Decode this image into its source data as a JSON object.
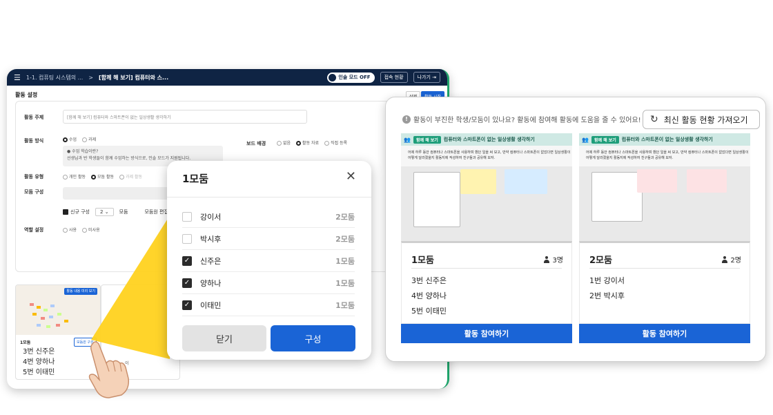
{
  "app": {
    "breadcrumb": "1-1. 컴퓨팅 시스템의 ...",
    "title": "[함께 해 보기] 컴퓨터와 스...",
    "mode_toggle": "인솔 모드 OFF",
    "access_status": "접속 현황",
    "exit": "나가기",
    "section_title": "활동 설정",
    "delete_btn": "삭제",
    "start_btn": "활동 시작",
    "fields": {
      "topic_label": "활동 주제",
      "topic_value": "[함께 해 보기] 컴퓨터와 스마트폰이 없는 일상생활 생각하기",
      "method_label": "활동 방식",
      "method_opt1": "수업",
      "method_opt2": "과제",
      "info_title": "수업 학습이란?",
      "info_text": "선생님과 반 학생들이 함께 수업하는 방식으로, 인솔 모드가 지원됩니다.",
      "board_label": "보드 배경",
      "board_opt1": "없음",
      "board_opt2": "활동 자료",
      "board_opt3": "직접 등록",
      "type_label": "활동 유형",
      "type_opt1": "개인 활동",
      "type_opt2": "모둠 활동",
      "type_opt3": "과제 활동",
      "group_label": "모둠 구성",
      "new_group": "신규 구성",
      "group_count": "2",
      "group_unit": "모둠",
      "group_edit": "모둠원 편집 편성",
      "role_label": "역할 설정",
      "role_opt1": "사용",
      "role_opt2": "미사용"
    },
    "thumb": {
      "badge": "활동 내용 미리 보기",
      "name": "1모둠",
      "btn": "모둠원 구성",
      "members": [
        "3번 신주은",
        "4번 양하나",
        "5번 이태민"
      ],
      "card2_text": "이"
    }
  },
  "modal": {
    "title": "1모둠",
    "rows": [
      {
        "name": "강이서",
        "group": "2모둠",
        "checked": false
      },
      {
        "name": "박시후",
        "group": "2모둠",
        "checked": false
      },
      {
        "name": "신주은",
        "group": "1모둠",
        "checked": true
      },
      {
        "name": "양하나",
        "group": "1모둠",
        "checked": true
      },
      {
        "name": "이태민",
        "group": "1모둠",
        "checked": true
      }
    ],
    "close_label": "닫기",
    "compose_label": "구성"
  },
  "right": {
    "notice": "활동이 부진한 학생/모둠이 있나요? 활동에 참여해 활동에 도움을 줄 수 있어요!",
    "refresh_label": "최신 활동 현황 가져오기",
    "cards": [
      {
        "tag": "함께 해 보기",
        "header": "컴퓨터와 스마트폰이 없는 일상생활 생각하기",
        "desc": "어제 하루 동안 컴퓨터나 스마트폰을 사용하며 했던 일을 써 보고, 만약 컴퓨터나 스마트폰이 없었다면 일상생활이 어떻게 달라졌을지 활동지에 작성하여 친구들과 공유해 보자.",
        "name": "1모둠",
        "count": "3명",
        "members": [
          "3번 신주은",
          "4번 양하나",
          "5번 이태민"
        ],
        "join_label": "활동 참여하기"
      },
      {
        "tag": "함께 해 보기",
        "header": "컴퓨터와 스마트폰이 없는 일상생활 생각하기",
        "desc": "어제 하루 동안 컴퓨터나 스마트폰을 사용하며 했던 일을 써 보고, 만약 컴퓨터나 스마트폰이 없었다면 일상생활이 어떻게 달라졌을지 활동지에 작성하여 친구들과 공유해 보자.",
        "name": "2모둠",
        "count": "2명",
        "members": [
          "1번 강이서",
          "2번 박시후"
        ],
        "join_label": "활동 참여하기"
      }
    ]
  },
  "colors": {
    "primary": "#1a64d6",
    "topbar": "#0f2444",
    "highlight": "#ffd21f",
    "header_tint": "#cfe9e4"
  }
}
